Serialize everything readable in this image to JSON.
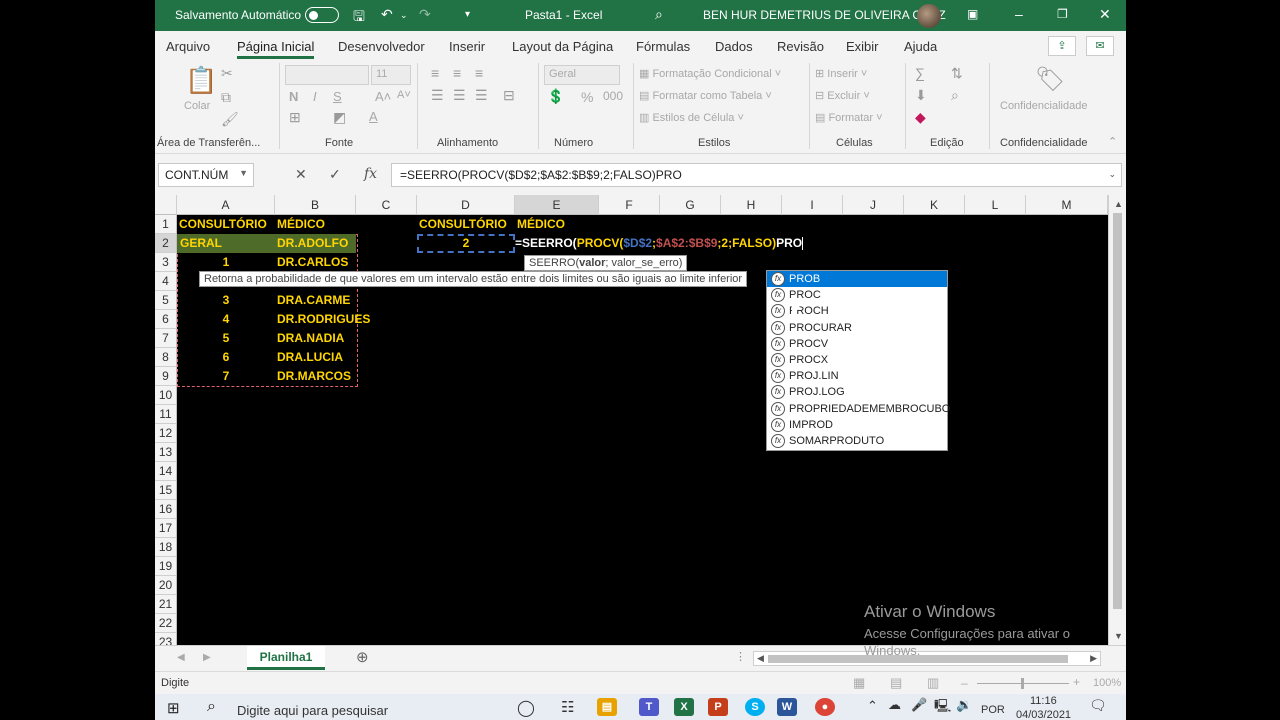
{
  "window": {
    "autosave_label": "Salvamento Automático",
    "title": "Pasta1  -  Excel",
    "user": "BEN HUR DEMETRIUS DE OLIVEIRA CRUZ"
  },
  "menu": [
    "Arquivo",
    "Página Inicial",
    "Desenvolvedor",
    "Inserir",
    "Layout da Página",
    "Fórmulas",
    "Dados",
    "Revisão",
    "Exibir",
    "Ajuda"
  ],
  "ribbon": {
    "groups": [
      "Área de Transferên...",
      "Fonte",
      "Alinhamento",
      "Número",
      "Estilos",
      "Células",
      "Edição",
      "Confidencialidade"
    ],
    "paste": "Colar",
    "font_size": "11",
    "number_format": "Geral",
    "cond_format": "Formatação Condicional",
    "format_table": "Formatar como Tabela",
    "cell_styles": "Estilos de Célula",
    "insert": "Inserir",
    "delete": "Excluir",
    "format": "Formatar",
    "confidentiality": "Confidencialidade"
  },
  "formula_bar": {
    "name_box": "CONT.NÚM",
    "formula": "=SEERRO(PROCV($D$2;$A$2:$B$9;2;FALSO)PRO"
  },
  "columns": [
    "A",
    "B",
    "C",
    "D",
    "E",
    "F",
    "G",
    "H",
    "I",
    "J",
    "K",
    "L",
    "M"
  ],
  "rows": [
    "1",
    "2",
    "3",
    "4",
    "5",
    "6",
    "7",
    "8",
    "9",
    "10",
    "11",
    "12",
    "13",
    "14",
    "15",
    "16",
    "17",
    "18",
    "19",
    "20",
    "21",
    "22",
    "23"
  ],
  "table": {
    "header_a": "CONSULTÓRIO",
    "header_b": "MÉDICO",
    "cells": [
      {
        "a": "GERAL",
        "b": "DR.ADOLFO"
      },
      {
        "a": "1",
        "b": "DR.CARLOS"
      },
      {
        "a": "",
        "b": ""
      },
      {
        "a": "3",
        "b": "DRA.CARME"
      },
      {
        "a": "4",
        "b": "DR.RODRIGUES"
      },
      {
        "a": "5",
        "b": "DRA.NADIA"
      },
      {
        "a": "6",
        "b": "DRA.LUCIA"
      },
      {
        "a": "7",
        "b": "DR.MARCOS"
      }
    ]
  },
  "lookup": {
    "header_d": "CONSULTÓRIO",
    "header_e": "MÉDICO",
    "d2": "2",
    "e2_formula": {
      "p1": "=SEERRO(",
      "p2": "PROCV(",
      "p3": "$D$2",
      "p4": ";",
      "p5": "$A$2:$B$9",
      "p6": ";2;FALSO)",
      "p7": "PRO"
    }
  },
  "tooltips": {
    "syntax": "SEERRO(valor; valor_se_erro)",
    "syntax_fn": "SEERRO(",
    "syntax_arg1": "valor",
    "syntax_rest": "; valor_se_erro)",
    "description": "Retorna a probabilidade de que valores em um intervalo estão entre dois limites ou são iguais ao limite inferior"
  },
  "autocomplete": [
    "PROB",
    "PROC",
    "PROCH",
    "PROCURAR",
    "PROCV",
    "PROCX",
    "PROJ.LIN",
    "PROJ.LOG",
    "PROPRIEDADEMEMBROCUBO",
    "IMPROD",
    "SOMARPRODUTO"
  ],
  "sheet_tab": "Planilha1",
  "status": {
    "mode": "Digite",
    "zoom": "100%"
  },
  "watermark": {
    "title": "Ativar o Windows",
    "line1": "Acesse Configurações para ativar o",
    "line2": "Windows."
  },
  "taskbar": {
    "search_placeholder": "Digite aqui para pesquisar",
    "lang": "POR",
    "time": "11:16",
    "date": "04/03/2021"
  },
  "colors": {
    "excel_green": "#217346",
    "cell_text_yellow": "#ffd600",
    "ref_blue": "#4472c4",
    "ref_red": "#c0504d"
  }
}
